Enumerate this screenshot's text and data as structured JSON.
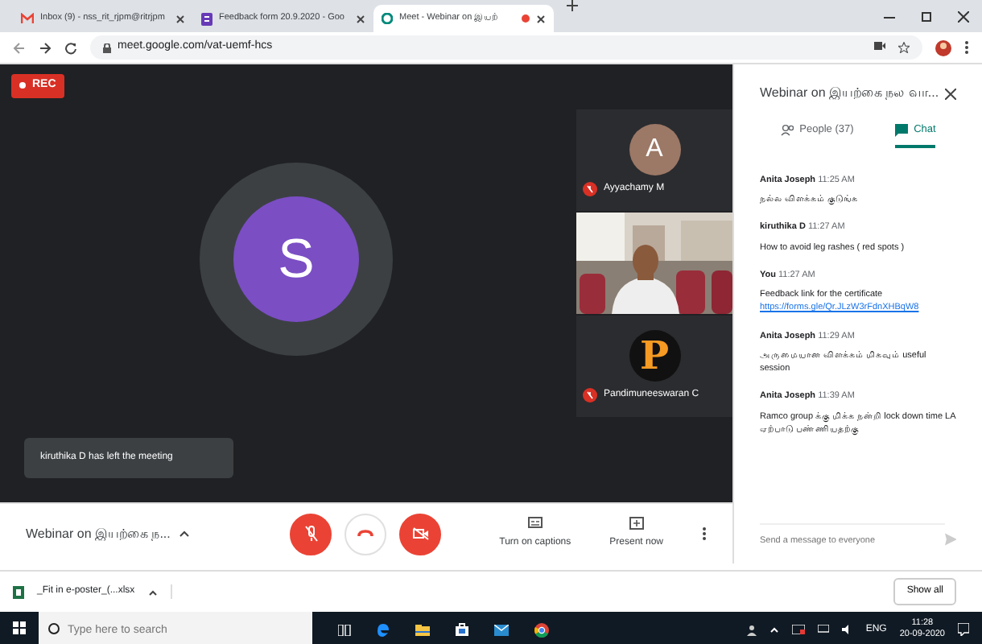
{
  "browser": {
    "tabs": [
      {
        "kind": "mail",
        "title": "Inbox (9) - nss_rit_rjpm@ritrjpm",
        "selected": false,
        "recording": false
      },
      {
        "kind": "form",
        "title": "Feedback form 20.9.2020 - Goo",
        "selected": false,
        "recording": false
      },
      {
        "kind": "meet",
        "title": "Meet - Webinar on இயற்",
        "selected": true,
        "recording": true
      }
    ],
    "url": "meet.google.com/vat-uemf-hcs"
  },
  "meeting": {
    "rec": "REC",
    "main_avatar": "S",
    "notice": "kiruthika D has left the meeting",
    "tiles": [
      {
        "kind": "avatar",
        "letter": "A",
        "name": "Ayyachamy M",
        "muted": true
      },
      {
        "kind": "video"
      },
      {
        "kind": "logo",
        "letter": "P",
        "name": "Pandimuneeswaran C",
        "muted": true
      }
    ],
    "title": "Webinar on இயற்கை ந...",
    "mic_off": true,
    "camera_off": true,
    "actions": [
      {
        "kind": "captions",
        "label": "Turn on captions"
      },
      {
        "kind": "present",
        "label": "Present now"
      }
    ]
  },
  "chat_panel": {
    "title": "Webinar on இயற்கை நல வா...",
    "tabs": [
      {
        "kind": "people",
        "label": "People (37)",
        "selected": false
      },
      {
        "kind": "chat",
        "label": "Chat",
        "selected": true
      }
    ],
    "messages": [
      {
        "sender": "Anita Joseph",
        "time": "11:25 AM",
        "text": "நல்ல விளக்கம் குடுங்க"
      },
      {
        "sender": "kiruthika D",
        "time": "11:27 AM",
        "text": "How to avoid leg rashes ( red spots )"
      },
      {
        "sender": "You",
        "time": "11:27 AM",
        "text": "Feedback link for the certificate",
        "link": "https://forms.gle/Qr.JLzW3rFdnXHBqW8"
      },
      {
        "sender": "Anita Joseph",
        "time": "11:29 AM",
        "text": "அருமையான விளக்கம் மிகவும் useful session"
      },
      {
        "sender": "Anita Joseph",
        "time": "11:39 AM",
        "text": "Ramco group க்கு மிக்க நன்றி lock down time LA ஏற்பாடு பண்ணியதற்கு"
      }
    ],
    "placeholder": "Send a message to everyone"
  },
  "downloads": {
    "file": "_Fit in e-poster_(...xlsx",
    "show_all": "Show all"
  },
  "taskbar": {
    "search_placeholder": "Type here to search",
    "language": "ENG",
    "time": "11:28",
    "date": "20-09-2020"
  }
}
